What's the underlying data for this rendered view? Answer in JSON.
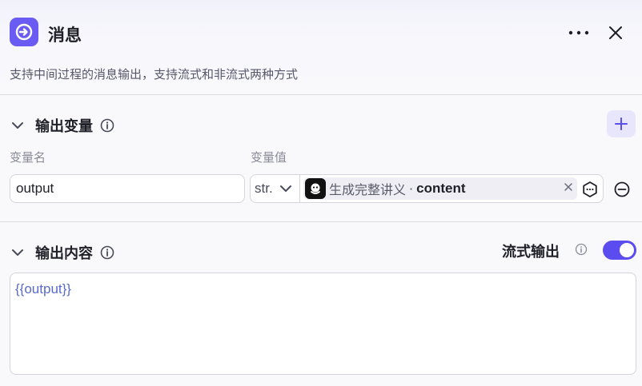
{
  "header": {
    "title": "消息",
    "icon": "arrow-right-circle-icon",
    "accent": "#6a5cf2"
  },
  "description": "支持中间过程的消息输出，支持流式和非流式两种方式",
  "output_variables": {
    "section_label": "输出变量",
    "col_name_label": "变量名",
    "col_value_label": "变量值",
    "rows": [
      {
        "name": "output",
        "type": "str.",
        "ref_node": "生成完整讲义",
        "ref_sep": "·",
        "ref_field": "content"
      }
    ]
  },
  "output_content": {
    "section_label": "输出内容",
    "stream_label": "流式输出",
    "stream_enabled": true,
    "content": "{{output}}"
  },
  "colors": {
    "toggle_on": "#5b4cf0",
    "template_var": "#5a6bc9"
  }
}
